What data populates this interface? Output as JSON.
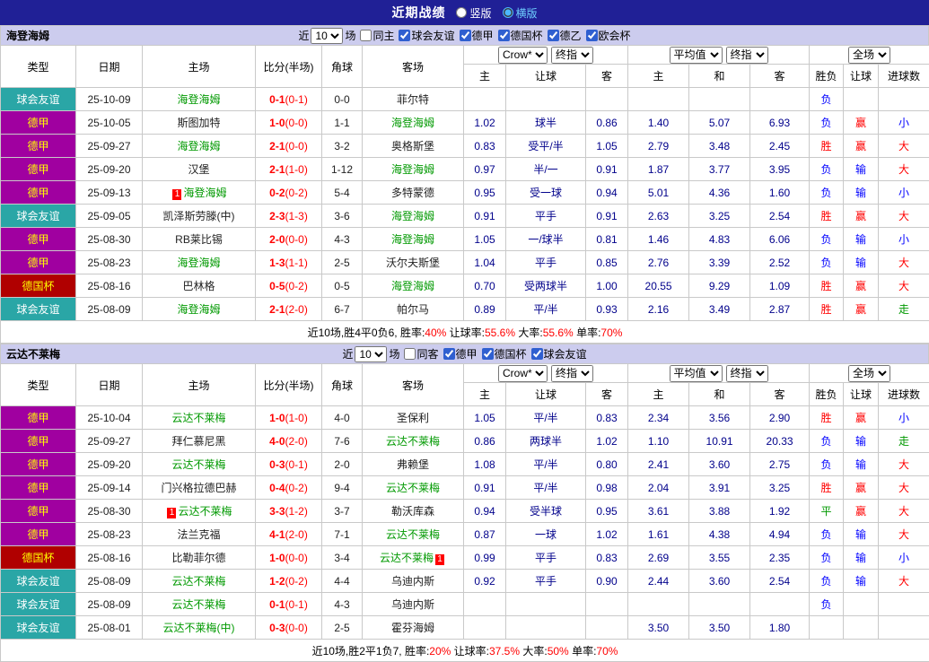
{
  "topbar": {
    "title": "近期战绩",
    "radios": [
      {
        "label": "竖版",
        "checked": false
      },
      {
        "label": "横版",
        "checked": true
      }
    ]
  },
  "table_columns": {
    "type": "类型",
    "date": "日期",
    "home": "主场",
    "score": "比分(半场)",
    "corner": "角球",
    "away": "客场",
    "asia": [
      "主",
      "让球",
      "客"
    ],
    "euro": [
      "主",
      "和",
      "客"
    ],
    "result": [
      "胜负",
      "让球",
      "进球数"
    ]
  },
  "type_colors": {
    "friendly": {
      "bg": "#2aa6a6",
      "fg": "#ffffff"
    },
    "bundesliga": {
      "bg": "#a000a0",
      "fg": "#ffff00"
    },
    "cup": {
      "bg": "#b00000",
      "fg": "#ffff00"
    }
  },
  "result_colors": {
    "r": "#ff0000",
    "b": "#0000ff",
    "g": "#009900"
  },
  "sections": [
    {
      "team": "海登海姆",
      "filter": {
        "prefix": "近",
        "count": "10",
        "suffix": "场",
        "same": {
          "label": "同主",
          "checked": false
        },
        "leagues": [
          {
            "label": "球会友谊",
            "checked": true
          },
          {
            "label": "德甲",
            "checked": true
          },
          {
            "label": "德国杯",
            "checked": true
          },
          {
            "label": "德乙",
            "checked": true
          },
          {
            "label": "欧会杯",
            "checked": true
          }
        ]
      },
      "selects": {
        "bookmaker": "Crow*",
        "asia_final": "终指",
        "euro_avg": "平均值",
        "euro_final": "终指",
        "scope": "全场"
      },
      "rows": [
        {
          "type": "球会友谊",
          "tcls": "friendly",
          "date": "25-10-09",
          "home": {
            "name": "海登海姆",
            "focus": true
          },
          "score": "0-1",
          "half": "(0-1)",
          "corner": "0-0",
          "away": {
            "name": "菲尔特",
            "focus": false
          },
          "ah": [
            "",
            "",
            ""
          ],
          "eu": [
            "",
            "",
            ""
          ],
          "res": [
            [
              "负",
              "b"
            ],
            [
              "",
              ""
            ],
            [
              "",
              ""
            ]
          ]
        },
        {
          "type": "德甲",
          "tcls": "bundesliga",
          "date": "25-10-05",
          "home": {
            "name": "斯图加特",
            "focus": false
          },
          "score": "1-0",
          "half": "(0-0)",
          "corner": "1-1",
          "away": {
            "name": "海登海姆",
            "focus": true
          },
          "ah": [
            "1.02",
            "球半",
            "0.86"
          ],
          "eu": [
            "1.40",
            "5.07",
            "6.93"
          ],
          "res": [
            [
              "负",
              "b"
            ],
            [
              "赢",
              "r"
            ],
            [
              "小",
              "b"
            ]
          ]
        },
        {
          "type": "德甲",
          "tcls": "bundesliga",
          "date": "25-09-27",
          "home": {
            "name": "海登海姆",
            "focus": true
          },
          "score": "2-1",
          "half": "(0-0)",
          "corner": "3-2",
          "away": {
            "name": "奥格斯堡",
            "focus": false
          },
          "ah": [
            "0.83",
            "受平/半",
            "1.05"
          ],
          "eu": [
            "2.79",
            "3.48",
            "2.45"
          ],
          "res": [
            [
              "胜",
              "r"
            ],
            [
              "赢",
              "r"
            ],
            [
              "大",
              "r"
            ]
          ]
        },
        {
          "type": "德甲",
          "tcls": "bundesliga",
          "date": "25-09-20",
          "home": {
            "name": "汉堡",
            "focus": false
          },
          "score": "2-1",
          "half": "(1-0)",
          "corner": "1-12",
          "away": {
            "name": "海登海姆",
            "focus": true
          },
          "ah": [
            "0.97",
            "半/一",
            "0.91"
          ],
          "eu": [
            "1.87",
            "3.77",
            "3.95"
          ],
          "res": [
            [
              "负",
              "b"
            ],
            [
              "输",
              "b"
            ],
            [
              "大",
              "r"
            ]
          ]
        },
        {
          "type": "德甲",
          "tcls": "bundesliga",
          "date": "25-09-13",
          "home": {
            "name": "海登海姆",
            "focus": true,
            "card": "1",
            "cardSide": "left"
          },
          "score": "0-2",
          "half": "(0-2)",
          "corner": "5-4",
          "away": {
            "name": "多特蒙德",
            "focus": false
          },
          "ah": [
            "0.95",
            "受一球",
            "0.94"
          ],
          "eu": [
            "5.01",
            "4.36",
            "1.60"
          ],
          "res": [
            [
              "负",
              "b"
            ],
            [
              "输",
              "b"
            ],
            [
              "小",
              "b"
            ]
          ]
        },
        {
          "type": "球会友谊",
          "tcls": "friendly",
          "date": "25-09-05",
          "home": {
            "name": "凯泽斯劳滕(中)",
            "focus": false
          },
          "score": "2-3",
          "half": "(1-3)",
          "corner": "3-6",
          "away": {
            "name": "海登海姆",
            "focus": true
          },
          "ah": [
            "0.91",
            "平手",
            "0.91"
          ],
          "eu": [
            "2.63",
            "3.25",
            "2.54"
          ],
          "res": [
            [
              "胜",
              "r"
            ],
            [
              "赢",
              "r"
            ],
            [
              "大",
              "r"
            ]
          ]
        },
        {
          "type": "德甲",
          "tcls": "bundesliga",
          "date": "25-08-30",
          "home": {
            "name": "RB莱比锡",
            "focus": false
          },
          "score": "2-0",
          "half": "(0-0)",
          "corner": "4-3",
          "away": {
            "name": "海登海姆",
            "focus": true
          },
          "ah": [
            "1.05",
            "一/球半",
            "0.81"
          ],
          "eu": [
            "1.46",
            "4.83",
            "6.06"
          ],
          "res": [
            [
              "负",
              "b"
            ],
            [
              "输",
              "b"
            ],
            [
              "小",
              "b"
            ]
          ]
        },
        {
          "type": "德甲",
          "tcls": "bundesliga",
          "date": "25-08-23",
          "home": {
            "name": "海登海姆",
            "focus": true
          },
          "score": "1-3",
          "half": "(1-1)",
          "corner": "2-5",
          "away": {
            "name": "沃尔夫斯堡",
            "focus": false
          },
          "ah": [
            "1.04",
            "平手",
            "0.85"
          ],
          "eu": [
            "2.76",
            "3.39",
            "2.52"
          ],
          "res": [
            [
              "负",
              "b"
            ],
            [
              "输",
              "b"
            ],
            [
              "大",
              "r"
            ]
          ]
        },
        {
          "type": "德国杯",
          "tcls": "cup",
          "date": "25-08-16",
          "home": {
            "name": "巴林格",
            "focus": false
          },
          "score": "0-5",
          "half": "(0-2)",
          "corner": "0-5",
          "away": {
            "name": "海登海姆",
            "focus": true
          },
          "ah": [
            "0.70",
            "受两球半",
            "1.00"
          ],
          "eu": [
            "20.55",
            "9.29",
            "1.09"
          ],
          "res": [
            [
              "胜",
              "r"
            ],
            [
              "赢",
              "r"
            ],
            [
              "大",
              "r"
            ]
          ]
        },
        {
          "type": "球会友谊",
          "tcls": "friendly",
          "date": "25-08-09",
          "home": {
            "name": "海登海姆",
            "focus": true
          },
          "score": "2-1",
          "half": "(2-0)",
          "corner": "6-7",
          "away": {
            "name": "帕尔马",
            "focus": false
          },
          "ah": [
            "0.89",
            "平/半",
            "0.93"
          ],
          "eu": [
            "2.16",
            "3.49",
            "2.87"
          ],
          "res": [
            [
              "胜",
              "r"
            ],
            [
              "赢",
              "r"
            ],
            [
              "走",
              "g"
            ]
          ]
        }
      ],
      "summary": [
        {
          "t": "近10场,胜4平0负6, 胜率:",
          "c": "k"
        },
        {
          "t": "40%",
          "c": "r"
        },
        {
          "t": " 让球率:",
          "c": "k"
        },
        {
          "t": "55.6%",
          "c": "r"
        },
        {
          "t": " 大率:",
          "c": "k"
        },
        {
          "t": "55.6%",
          "c": "r"
        },
        {
          "t": " 单率:",
          "c": "k"
        },
        {
          "t": "70%",
          "c": "r"
        }
      ]
    },
    {
      "team": "云达不莱梅",
      "filter": {
        "prefix": "近",
        "count": "10",
        "suffix": "场",
        "same": {
          "label": "同客",
          "checked": false
        },
        "leagues": [
          {
            "label": "德甲",
            "checked": true
          },
          {
            "label": "德国杯",
            "checked": true
          },
          {
            "label": "球会友谊",
            "checked": true
          }
        ]
      },
      "selects": {
        "bookmaker": "Crow*",
        "asia_final": "终指",
        "euro_avg": "平均值",
        "euro_final": "终指",
        "scope": "全场"
      },
      "rows": [
        {
          "type": "德甲",
          "tcls": "bundesliga",
          "date": "25-10-04",
          "home": {
            "name": "云达不莱梅",
            "focus": true
          },
          "score": "1-0",
          "half": "(1-0)",
          "corner": "4-0",
          "away": {
            "name": "圣保利",
            "focus": false
          },
          "ah": [
            "1.05",
            "平/半",
            "0.83"
          ],
          "eu": [
            "2.34",
            "3.56",
            "2.90"
          ],
          "res": [
            [
              "胜",
              "r"
            ],
            [
              "赢",
              "r"
            ],
            [
              "小",
              "b"
            ]
          ]
        },
        {
          "type": "德甲",
          "tcls": "bundesliga",
          "date": "25-09-27",
          "home": {
            "name": "拜仁慕尼黑",
            "focus": false
          },
          "score": "4-0",
          "half": "(2-0)",
          "corner": "7-6",
          "away": {
            "name": "云达不莱梅",
            "focus": true
          },
          "ah": [
            "0.86",
            "两球半",
            "1.02"
          ],
          "eu": [
            "1.10",
            "10.91",
            "20.33"
          ],
          "res": [
            [
              "负",
              "b"
            ],
            [
              "输",
              "b"
            ],
            [
              "走",
              "g"
            ]
          ]
        },
        {
          "type": "德甲",
          "tcls": "bundesliga",
          "date": "25-09-20",
          "home": {
            "name": "云达不莱梅",
            "focus": true
          },
          "score": "0-3",
          "half": "(0-1)",
          "corner": "2-0",
          "away": {
            "name": "弗赖堡",
            "focus": false
          },
          "ah": [
            "1.08",
            "平/半",
            "0.80"
          ],
          "eu": [
            "2.41",
            "3.60",
            "2.75"
          ],
          "res": [
            [
              "负",
              "b"
            ],
            [
              "输",
              "b"
            ],
            [
              "大",
              "r"
            ]
          ]
        },
        {
          "type": "德甲",
          "tcls": "bundesliga",
          "date": "25-09-14",
          "home": {
            "name": "门兴格拉德巴赫",
            "focus": false
          },
          "score": "0-4",
          "half": "(0-2)",
          "corner": "9-4",
          "away": {
            "name": "云达不莱梅",
            "focus": true
          },
          "ah": [
            "0.91",
            "平/半",
            "0.98"
          ],
          "eu": [
            "2.04",
            "3.91",
            "3.25"
          ],
          "res": [
            [
              "胜",
              "r"
            ],
            [
              "赢",
              "r"
            ],
            [
              "大",
              "r"
            ]
          ]
        },
        {
          "type": "德甲",
          "tcls": "bundesliga",
          "date": "25-08-30",
          "home": {
            "name": "云达不莱梅",
            "focus": true,
            "card": "1",
            "cardSide": "left"
          },
          "score": "3-3",
          "half": "(1-2)",
          "corner": "3-7",
          "away": {
            "name": "勒沃库森",
            "focus": false
          },
          "ah": [
            "0.94",
            "受半球",
            "0.95"
          ],
          "eu": [
            "3.61",
            "3.88",
            "1.92"
          ],
          "res": [
            [
              "平",
              "g"
            ],
            [
              "赢",
              "r"
            ],
            [
              "大",
              "r"
            ]
          ]
        },
        {
          "type": "德甲",
          "tcls": "bundesliga",
          "date": "25-08-23",
          "home": {
            "name": "法兰克福",
            "focus": false
          },
          "score": "4-1",
          "half": "(2-0)",
          "corner": "7-1",
          "away": {
            "name": "云达不莱梅",
            "focus": true
          },
          "ah": [
            "0.87",
            "一球",
            "1.02"
          ],
          "eu": [
            "1.61",
            "4.38",
            "4.94"
          ],
          "res": [
            [
              "负",
              "b"
            ],
            [
              "输",
              "b"
            ],
            [
              "大",
              "r"
            ]
          ]
        },
        {
          "type": "德国杯",
          "tcls": "cup",
          "date": "25-08-16",
          "home": {
            "name": "比勒菲尔德",
            "focus": false
          },
          "score": "1-0",
          "half": "(0-0)",
          "corner": "3-4",
          "away": {
            "name": "云达不莱梅",
            "focus": true,
            "card": "1",
            "cardSide": "right"
          },
          "ah": [
            "0.99",
            "平手",
            "0.83"
          ],
          "eu": [
            "2.69",
            "3.55",
            "2.35"
          ],
          "res": [
            [
              "负",
              "b"
            ],
            [
              "输",
              "b"
            ],
            [
              "小",
              "b"
            ]
          ]
        },
        {
          "type": "球会友谊",
          "tcls": "friendly",
          "date": "25-08-09",
          "home": {
            "name": "云达不莱梅",
            "focus": true
          },
          "score": "1-2",
          "half": "(0-2)",
          "corner": "4-4",
          "away": {
            "name": "乌迪内斯",
            "focus": false
          },
          "ah": [
            "0.92",
            "平手",
            "0.90"
          ],
          "eu": [
            "2.44",
            "3.60",
            "2.54"
          ],
          "res": [
            [
              "负",
              "b"
            ],
            [
              "输",
              "b"
            ],
            [
              "大",
              "r"
            ]
          ]
        },
        {
          "type": "球会友谊",
          "tcls": "friendly",
          "date": "25-08-09",
          "home": {
            "name": "云达不莱梅",
            "focus": true
          },
          "score": "0-1",
          "half": "(0-1)",
          "corner": "4-3",
          "away": {
            "name": "乌迪内斯",
            "focus": false
          },
          "ah": [
            "",
            "",
            ""
          ],
          "eu": [
            "",
            "",
            ""
          ],
          "res": [
            [
              "负",
              "b"
            ],
            [
              "",
              ""
            ],
            [
              "",
              ""
            ]
          ]
        },
        {
          "type": "球会友谊",
          "tcls": "friendly",
          "date": "25-08-01",
          "home": {
            "name": "云达不莱梅(中)",
            "focus": true
          },
          "score": "0-3",
          "half": "(0-0)",
          "corner": "2-5",
          "away": {
            "name": "霍芬海姆",
            "focus": false
          },
          "ah": [
            "",
            "",
            ""
          ],
          "eu": [
            "3.50",
            "3.50",
            "1.80"
          ],
          "res": [
            [
              "",
              ""
            ],
            [
              "",
              ""
            ],
            [
              "",
              ""
            ]
          ]
        }
      ],
      "summary": [
        {
          "t": "近10场,胜2平1负7, 胜率:",
          "c": "k"
        },
        {
          "t": "20%",
          "c": "r"
        },
        {
          "t": " 让球率:",
          "c": "k"
        },
        {
          "t": "37.5%",
          "c": "r"
        },
        {
          "t": " 大率:",
          "c": "k"
        },
        {
          "t": "50%",
          "c": "r"
        },
        {
          "t": " 单率:",
          "c": "k"
        },
        {
          "t": "70%",
          "c": "r"
        }
      ]
    }
  ]
}
